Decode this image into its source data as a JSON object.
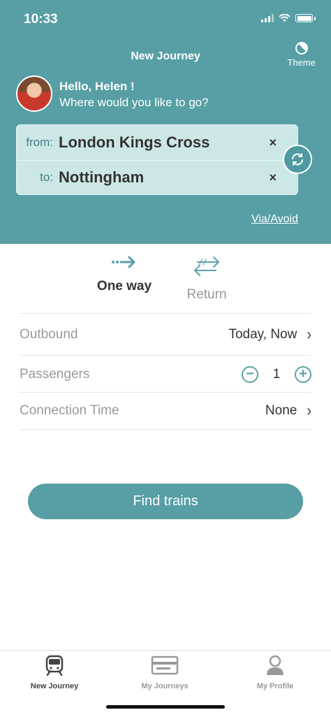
{
  "status_bar": {
    "time": "10:33"
  },
  "header": {
    "title": "New Journey",
    "theme_label": "Theme",
    "greeting_name": "Hello, Helen !",
    "greeting_sub": "Where would you like to go?"
  },
  "route": {
    "from_label": "from:",
    "from_value": "London Kings Cross",
    "to_label": "to:",
    "to_value": "Nottingham",
    "clear_glyph": "×",
    "via_avoid": "Via/Avoid"
  },
  "trip_type": {
    "one_way": "One way",
    "return": "Return",
    "selected": "One way"
  },
  "options": {
    "outbound_label": "Outbound",
    "outbound_value": "Today, Now",
    "passengers_label": "Passengers",
    "passengers_value": "1",
    "connection_label": "Connection Time",
    "connection_value": "None",
    "chevron": "›",
    "minus": "−",
    "plus": "+"
  },
  "find_button": "Find trains",
  "tabbar": {
    "items": [
      {
        "label": "New Journey",
        "icon": "train-icon",
        "active": true
      },
      {
        "label": "My Journeys",
        "icon": "ticket-icon",
        "active": false
      },
      {
        "label": "My Profile",
        "icon": "profile-icon",
        "active": false
      }
    ]
  },
  "colors": {
    "brand": "#579fa5",
    "route_box": "#cde7e7"
  }
}
